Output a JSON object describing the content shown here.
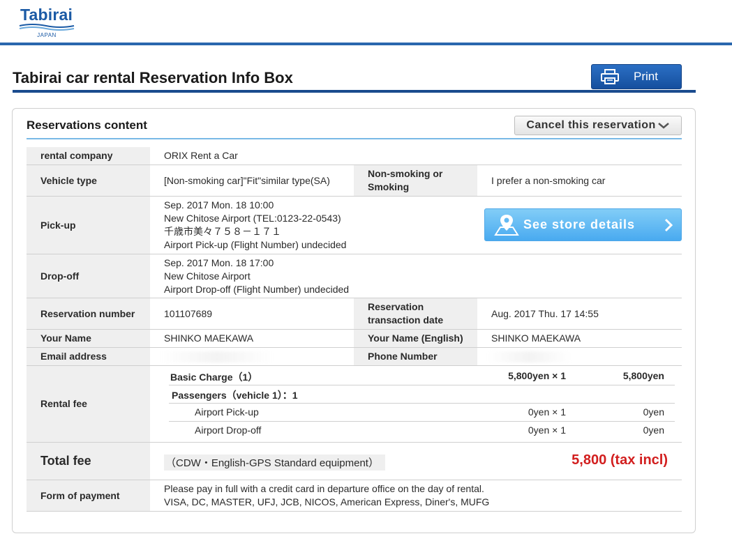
{
  "header": {
    "logo_text": "Tabirai",
    "logo_sub": "JAPAN",
    "brand_color": "#1b5aa5"
  },
  "page": {
    "title": "Tabirai car rental Reservation Info Box",
    "print_label": "Print"
  },
  "panel": {
    "title": "Reservations content",
    "cancel_label": "Cancel this reservation"
  },
  "reservation": {
    "rental_company": {
      "label": "rental company",
      "value": "ORIX Rent a Car"
    },
    "vehicle_type": {
      "label": "Vehicle type",
      "value": "[Non-smoking car]\"Fit\"similar type(SA)"
    },
    "smoking": {
      "label": "Non-smoking or Smoking",
      "value": "I prefer a non-smoking car"
    },
    "pickup": {
      "label": "Pick-up",
      "lines": [
        "Sep. 2017 Mon. 18 10:00",
        "New Chitose Airport (TEL:0123-22-0543)",
        "千歳市美々７５８－１７１",
        "Airport Pick-up (Flight Number) undecided"
      ],
      "store_button": "See store details"
    },
    "dropoff": {
      "label": "Drop-off",
      "lines": [
        "Sep. 2017 Mon. 18 17:00",
        "New Chitose Airport",
        "Airport Drop-off (Flight Number) undecided"
      ]
    },
    "reservation_number": {
      "label": "Reservation number",
      "value": "101107689"
    },
    "transaction_date": {
      "label": "Reservation transaction date",
      "value": "Aug. 2017 Thu. 17 14:55"
    },
    "your_name": {
      "label": "Your Name",
      "value": "SHINKO MAEKAWA"
    },
    "your_name_english": {
      "label": "Your Name (English)",
      "value": "SHINKO MAEKAWA"
    },
    "email": {
      "label": "Email address",
      "value": ""
    },
    "phone": {
      "label": "Phone Number",
      "value": ""
    },
    "rental_fee": {
      "label": "Rental fee",
      "items": [
        {
          "name": "Basic Charge（1）",
          "qty": "5,800yen × 1",
          "total": "5,800yen",
          "style": "bold"
        },
        {
          "name": "Passengers（vehicle 1）：1",
          "qty": "",
          "total": "",
          "style": "bold"
        },
        {
          "name": "Airport Pick-up",
          "qty": "0yen × 1",
          "total": "0yen",
          "style": "indent"
        },
        {
          "name": "Airport Drop-off",
          "qty": "0yen × 1",
          "total": "0yen",
          "style": "indent"
        }
      ]
    },
    "total_fee": {
      "label": "Total fee",
      "note": "（CDW・English-GPS Standard equipment）",
      "amount": "5,800 (tax incl)",
      "amount_color": "#d21e1e"
    },
    "payment": {
      "label": "Form of payment",
      "lines": [
        "Please pay in full with a credit card in departure office on the day of rental.",
        "VISA, DC, MASTER, UFJ, JCB, NICOS, American Express, Diner's, MUFG"
      ]
    }
  }
}
